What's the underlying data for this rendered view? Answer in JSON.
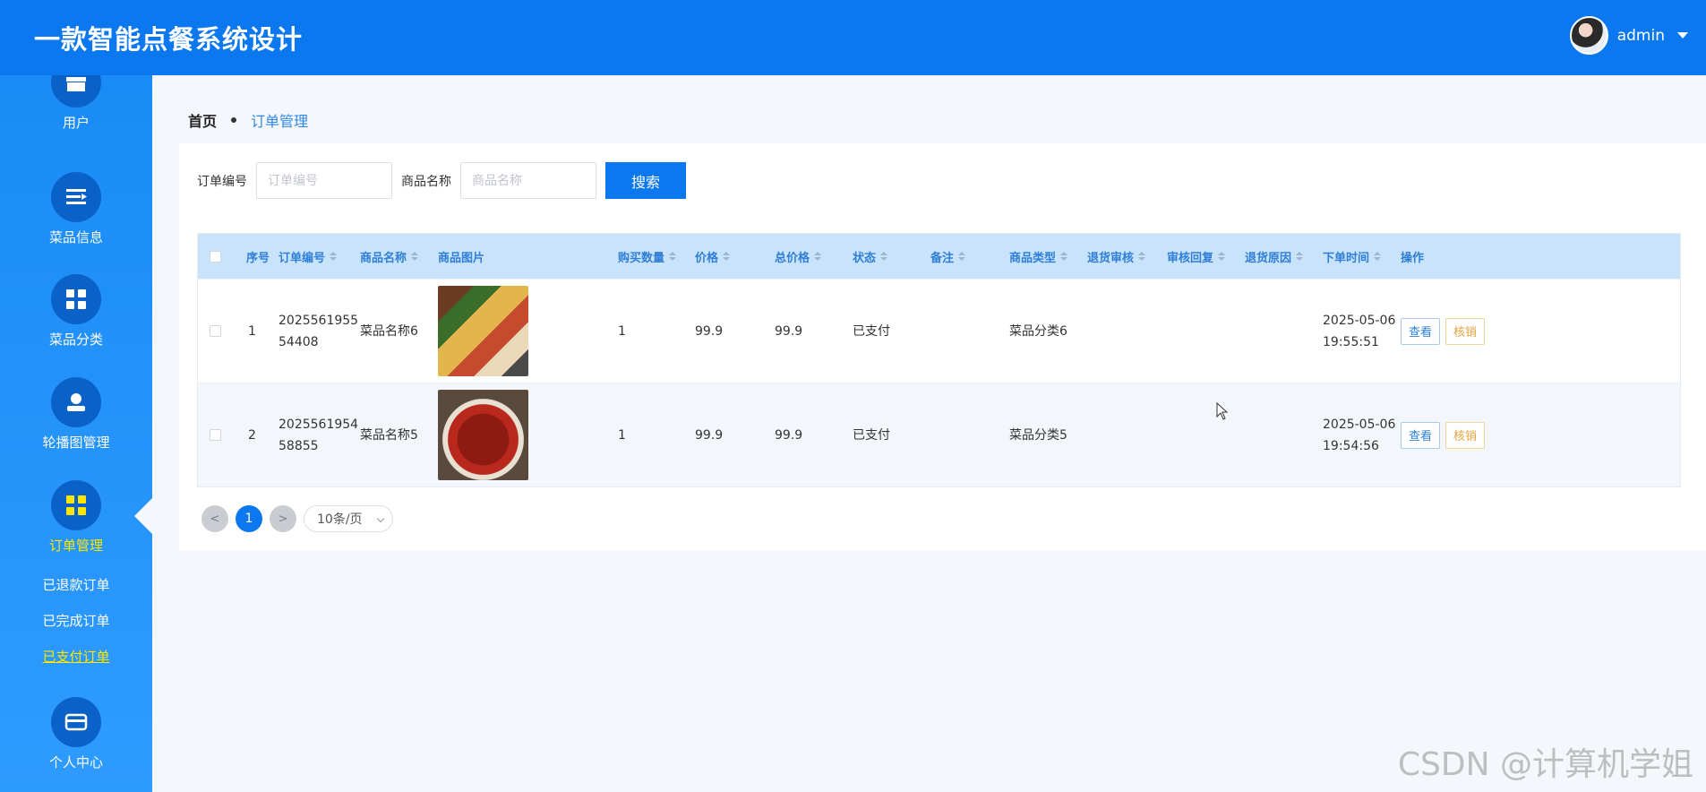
{
  "app": {
    "title": "一款智能点餐系统设计"
  },
  "user": {
    "name": "admin"
  },
  "sidebar": {
    "items": [
      {
        "label": "用户",
        "icon": "shop-icon"
      },
      {
        "label": "菜品信息",
        "icon": "list-icon"
      },
      {
        "label": "菜品分类",
        "icon": "grid-icon"
      },
      {
        "label": "轮播图管理",
        "icon": "user-icon"
      },
      {
        "label": "订单管理",
        "icon": "grid-icon"
      },
      {
        "label": "个人中心",
        "icon": "card-icon"
      }
    ],
    "sub_items": [
      "已退款订单",
      "已完成订单",
      "已支付订单"
    ]
  },
  "breadcrumb": {
    "home": "首页",
    "current": "订单管理"
  },
  "search": {
    "order_label": "订单编号",
    "order_placeholder": "订单编号",
    "product_label": "商品名称",
    "product_placeholder": "商品名称",
    "button": "搜索"
  },
  "table": {
    "headers": [
      "序号",
      "订单编号",
      "商品名称",
      "商品图片",
      "购买数量",
      "价格",
      "总价格",
      "状态",
      "备注",
      "商品类型",
      "退货审核",
      "审核回复",
      "退货原因",
      "下单时间",
      "操作"
    ],
    "rows": [
      {
        "index": "1",
        "order_no_1": "2025561955",
        "order_no_2": "54408",
        "product": "菜品名称6",
        "qty": "1",
        "price": "99.9",
        "total": "99.9",
        "status": "已支付",
        "note": "",
        "category": "菜品分类6",
        "return_review": "",
        "review_reply": "",
        "return_reason": "",
        "date": "2025-05-06",
        "time": "19:55:51"
      },
      {
        "index": "2",
        "order_no_1": "2025561954",
        "order_no_2": "58855",
        "product": "菜品名称5",
        "qty": "1",
        "price": "99.9",
        "total": "99.9",
        "status": "已支付",
        "note": "",
        "category": "菜品分类5",
        "return_review": "",
        "review_reply": "",
        "return_reason": "",
        "date": "2025-05-06",
        "time": "19:54:56"
      }
    ],
    "actions": {
      "view": "查看",
      "verify": "核销"
    }
  },
  "pagination": {
    "prev": "<",
    "page": "1",
    "next": ">",
    "page_size": "10条/页"
  },
  "watermark": "CSDN @计算机学姐"
}
